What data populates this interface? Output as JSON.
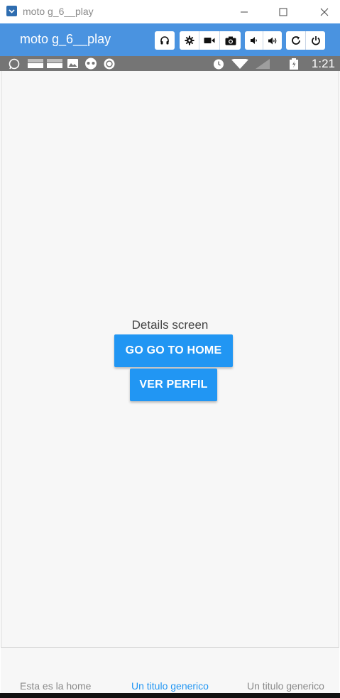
{
  "window": {
    "title": "moto g_6__play",
    "controls": [
      "minimize",
      "maximize",
      "close"
    ]
  },
  "toolbar": {
    "title": "moto g_6__play",
    "buttons": [
      "headphones-icon",
      "settings-icon",
      "camera-video-icon",
      "camera-icon",
      "volume-down-icon",
      "volume-up-icon",
      "rotate-icon",
      "power-icon"
    ],
    "accent": "#4a93e0"
  },
  "statusbar": {
    "time": "1:21",
    "background": "#757575"
  },
  "screen": {
    "label": "Details screen",
    "primary_button": "GO GO TO HOME",
    "secondary_button": "VER PERFIL",
    "button_color": "#2196f3"
  },
  "tabs": [
    {
      "label": "Esta es la home",
      "active": false
    },
    {
      "label": "Un titulo generico",
      "active": true
    },
    {
      "label": "Un titulo generico",
      "active": false
    }
  ],
  "colors": {
    "active_tab": "#2196f3",
    "inactive_tab": "#8a8a8a"
  }
}
